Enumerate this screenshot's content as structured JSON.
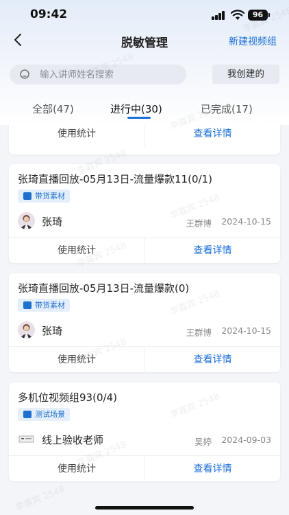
{
  "status_bar": {
    "time": "09:42",
    "battery": "96"
  },
  "nav": {
    "title": "脱敏管理",
    "new_group": "新建视频组"
  },
  "search": {
    "placeholder": "输入讲师姓名搜索",
    "value": ""
  },
  "filter": {
    "mine_label": "我创建的"
  },
  "tabs": [
    {
      "label": "全部(47)",
      "active": false
    },
    {
      "label": "进行中(30)",
      "active": true
    },
    {
      "label": "已完成(17)",
      "active": false
    }
  ],
  "card_actions": {
    "stats": "使用统计",
    "detail": "查看详情"
  },
  "cards": [
    {
      "title": "张琦直播回放-05月13日-流量爆款11(0/1)",
      "tag": "带货素材",
      "teacher": "张琦",
      "creator": "王群博",
      "date": "2024-10-15"
    },
    {
      "title": "张琦直播回放-05月13日-流量爆款(0)",
      "tag": "带货素材",
      "teacher": "张琦",
      "creator": "王群博",
      "date": "2024-10-15"
    },
    {
      "title": "多机位视频组93(0/4)",
      "tag": "测试场景",
      "teacher": "线上验收老师",
      "creator": "吴婷",
      "date": "2024-09-03"
    }
  ],
  "watermark": "李嘉宾 2548",
  "colors": {
    "accent": "#1a6ed8",
    "tag_bg": "#e4effb"
  }
}
